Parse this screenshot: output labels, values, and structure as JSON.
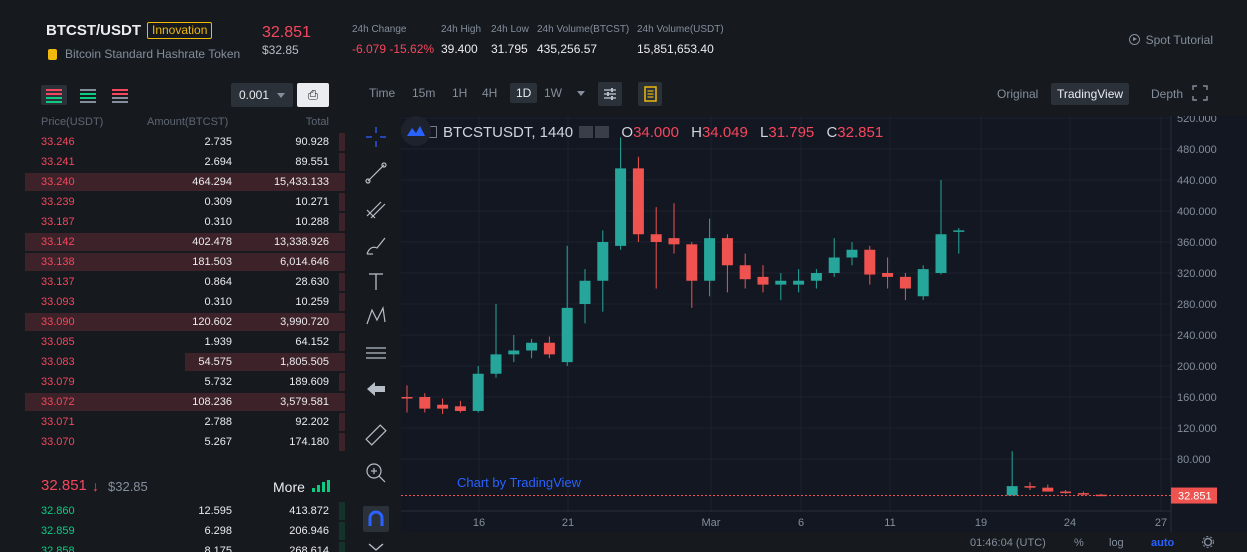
{
  "header": {
    "pair": "BTCST/USDT",
    "tag": "Innovation",
    "full_name": "Bitcoin Standard Hashrate Token",
    "last_price": "32.851",
    "last_price_usd": "$32.85",
    "stats": [
      {
        "label": "24h Change",
        "value": "-6.079 -15.62%",
        "color": "#f6465d"
      },
      {
        "label": "24h High",
        "value": "39.400",
        "color": "#eaecef"
      },
      {
        "label": "24h Low",
        "value": "31.795",
        "color": "#eaecef"
      },
      {
        "label": "24h Volume(BTCST)",
        "value": "435,256.57",
        "color": "#eaecef"
      },
      {
        "label": "24h Volume(USDT)",
        "value": "15,851,653.40",
        "color": "#eaecef"
      }
    ],
    "tutorial": "Spot Tutorial"
  },
  "orderbook": {
    "tick": "0.001",
    "headers": [
      "Price(USDT)",
      "Amount(BTCST)",
      "Total"
    ],
    "asks": [
      {
        "price": "33.246",
        "amount": "2.735",
        "total": "90.928",
        "depth": 0.02
      },
      {
        "price": "33.241",
        "amount": "2.694",
        "total": "89.551",
        "depth": 0.02
      },
      {
        "price": "33.240",
        "amount": "464.294",
        "total": "15,433.133",
        "depth": 1.0
      },
      {
        "price": "33.239",
        "amount": "0.309",
        "total": "10.271",
        "depth": 0.02
      },
      {
        "price": "33.187",
        "amount": "0.310",
        "total": "10.288",
        "depth": 0.02
      },
      {
        "price": "33.142",
        "amount": "402.478",
        "total": "13,338.926",
        "depth": 1.0
      },
      {
        "price": "33.138",
        "amount": "181.503",
        "total": "6,014.646",
        "depth": 1.0
      },
      {
        "price": "33.137",
        "amount": "0.864",
        "total": "28.630",
        "depth": 0.02
      },
      {
        "price": "33.093",
        "amount": "0.310",
        "total": "10.259",
        "depth": 0.02
      },
      {
        "price": "33.090",
        "amount": "120.602",
        "total": "3,990.720",
        "depth": 1.0
      },
      {
        "price": "33.085",
        "amount": "1.939",
        "total": "64.152",
        "depth": 0.02
      },
      {
        "price": "33.083",
        "amount": "54.575",
        "total": "1,805.505",
        "depth": 0.5
      },
      {
        "price": "33.079",
        "amount": "5.732",
        "total": "189.609",
        "depth": 0.02
      },
      {
        "price": "33.072",
        "amount": "108.236",
        "total": "3,579.581",
        "depth": 1.0
      },
      {
        "price": "33.071",
        "amount": "2.788",
        "total": "92.202",
        "depth": 0.02
      },
      {
        "price": "33.070",
        "amount": "5.267",
        "total": "174.180",
        "depth": 0.02
      }
    ],
    "mid_price": "32.851",
    "mid_arrow": "↓",
    "mid_usd": "$32.85",
    "more": "More",
    "bids": [
      {
        "price": "32.860",
        "amount": "12.595",
        "total": "413.872",
        "depth": 0.02
      },
      {
        "price": "32.859",
        "amount": "6.298",
        "total": "206.946",
        "depth": 0.02
      },
      {
        "price": "32.858",
        "amount": "8.175",
        "total": "268.614",
        "depth": 0.02
      }
    ]
  },
  "chart_toolbar": {
    "intervals": [
      "Time",
      "15m",
      "1H",
      "4H",
      "1D",
      "1W"
    ],
    "selected_interval": "1D",
    "views": [
      "Original",
      "TradingView",
      "Depth"
    ],
    "selected_view": "TradingView"
  },
  "chart_data": {
    "type": "candlestick",
    "symbol": "BTCSTUSDT, 1440",
    "ohlc_label": {
      "O": "34.000",
      "H": "34.049",
      "L": "31.795",
      "C": "32.851"
    },
    "y_ticks": [
      520,
      480,
      440,
      400,
      360,
      320,
      280,
      240,
      200,
      160,
      120,
      80
    ],
    "y_tick_labels": [
      "520.000",
      "480.000",
      "440.000",
      "400.000",
      "360.000",
      "320.000",
      "280.000",
      "240.000",
      "200.000",
      "160.000",
      "120.000",
      "80.000"
    ],
    "x_tick_labels": [
      "16",
      "21",
      "Mar",
      "6",
      "11",
      "19",
      "24",
      "27"
    ],
    "ylim": [
      0,
      530
    ],
    "current_price_label": "32.851",
    "candles": [
      {
        "o": 160,
        "h": 175,
        "l": 140,
        "c": 158
      },
      {
        "o": 160,
        "h": 165,
        "l": 140,
        "c": 145
      },
      {
        "o": 150,
        "h": 158,
        "l": 138,
        "c": 145
      },
      {
        "o": 148,
        "h": 155,
        "l": 140,
        "c": 142
      },
      {
        "o": 142,
        "h": 200,
        "l": 140,
        "c": 190
      },
      {
        "o": 190,
        "h": 280,
        "l": 185,
        "c": 215
      },
      {
        "o": 215,
        "h": 240,
        "l": 205,
        "c": 220
      },
      {
        "o": 220,
        "h": 235,
        "l": 210,
        "c": 230
      },
      {
        "o": 230,
        "h": 238,
        "l": 210,
        "c": 215
      },
      {
        "o": 205,
        "h": 355,
        "l": 200,
        "c": 275
      },
      {
        "o": 280,
        "h": 325,
        "l": 255,
        "c": 310
      },
      {
        "o": 310,
        "h": 375,
        "l": 270,
        "c": 360
      },
      {
        "o": 355,
        "h": 495,
        "l": 350,
        "c": 455
      },
      {
        "o": 455,
        "h": 470,
        "l": 360,
        "c": 370
      },
      {
        "o": 370,
        "h": 405,
        "l": 300,
        "c": 360
      },
      {
        "o": 365,
        "h": 410,
        "l": 345,
        "c": 357
      },
      {
        "o": 357,
        "h": 360,
        "l": 275,
        "c": 310
      },
      {
        "o": 310,
        "h": 390,
        "l": 290,
        "c": 365
      },
      {
        "o": 365,
        "h": 370,
        "l": 295,
        "c": 330
      },
      {
        "o": 330,
        "h": 345,
        "l": 300,
        "c": 312
      },
      {
        "o": 315,
        "h": 330,
        "l": 295,
        "c": 305
      },
      {
        "o": 305,
        "h": 320,
        "l": 285,
        "c": 310
      },
      {
        "o": 305,
        "h": 325,
        "l": 295,
        "c": 310
      },
      {
        "o": 310,
        "h": 325,
        "l": 300,
        "c": 320
      },
      {
        "o": 320,
        "h": 365,
        "l": 315,
        "c": 340
      },
      {
        "o": 340,
        "h": 360,
        "l": 330,
        "c": 350
      },
      {
        "o": 350,
        "h": 355,
        "l": 305,
        "c": 318
      },
      {
        "o": 320,
        "h": 340,
        "l": 300,
        "c": 315
      },
      {
        "o": 315,
        "h": 320,
        "l": 285,
        "c": 300
      },
      {
        "o": 290,
        "h": 330,
        "l": 285,
        "c": 325
      },
      {
        "o": 320,
        "h": 440,
        "l": 318,
        "c": 370
      },
      {
        "o": 375,
        "h": 378,
        "l": 345,
        "c": 375
      },
      null,
      null,
      {
        "o": 33,
        "h": 90,
        "l": 33,
        "c": 45
      },
      {
        "o": 45,
        "h": 50,
        "l": 40,
        "c": 43
      },
      {
        "o": 43,
        "h": 47,
        "l": 38,
        "c": 38
      },
      {
        "o": 38,
        "h": 40,
        "l": 35,
        "c": 36
      },
      {
        "o": 36,
        "h": 38,
        "l": 33,
        "c": 34
      },
      {
        "o": 34,
        "h": 35,
        "l": 32,
        "c": 33
      }
    ]
  },
  "chart_footer": {
    "time": "01:46:04 (UTC)",
    "percent": "%",
    "log": "log",
    "auto": "auto"
  },
  "watermark": "Chart by TradingView",
  "colors": {
    "up": "#26a69a",
    "down": "#ef5350",
    "accent": "#f0b90b"
  }
}
